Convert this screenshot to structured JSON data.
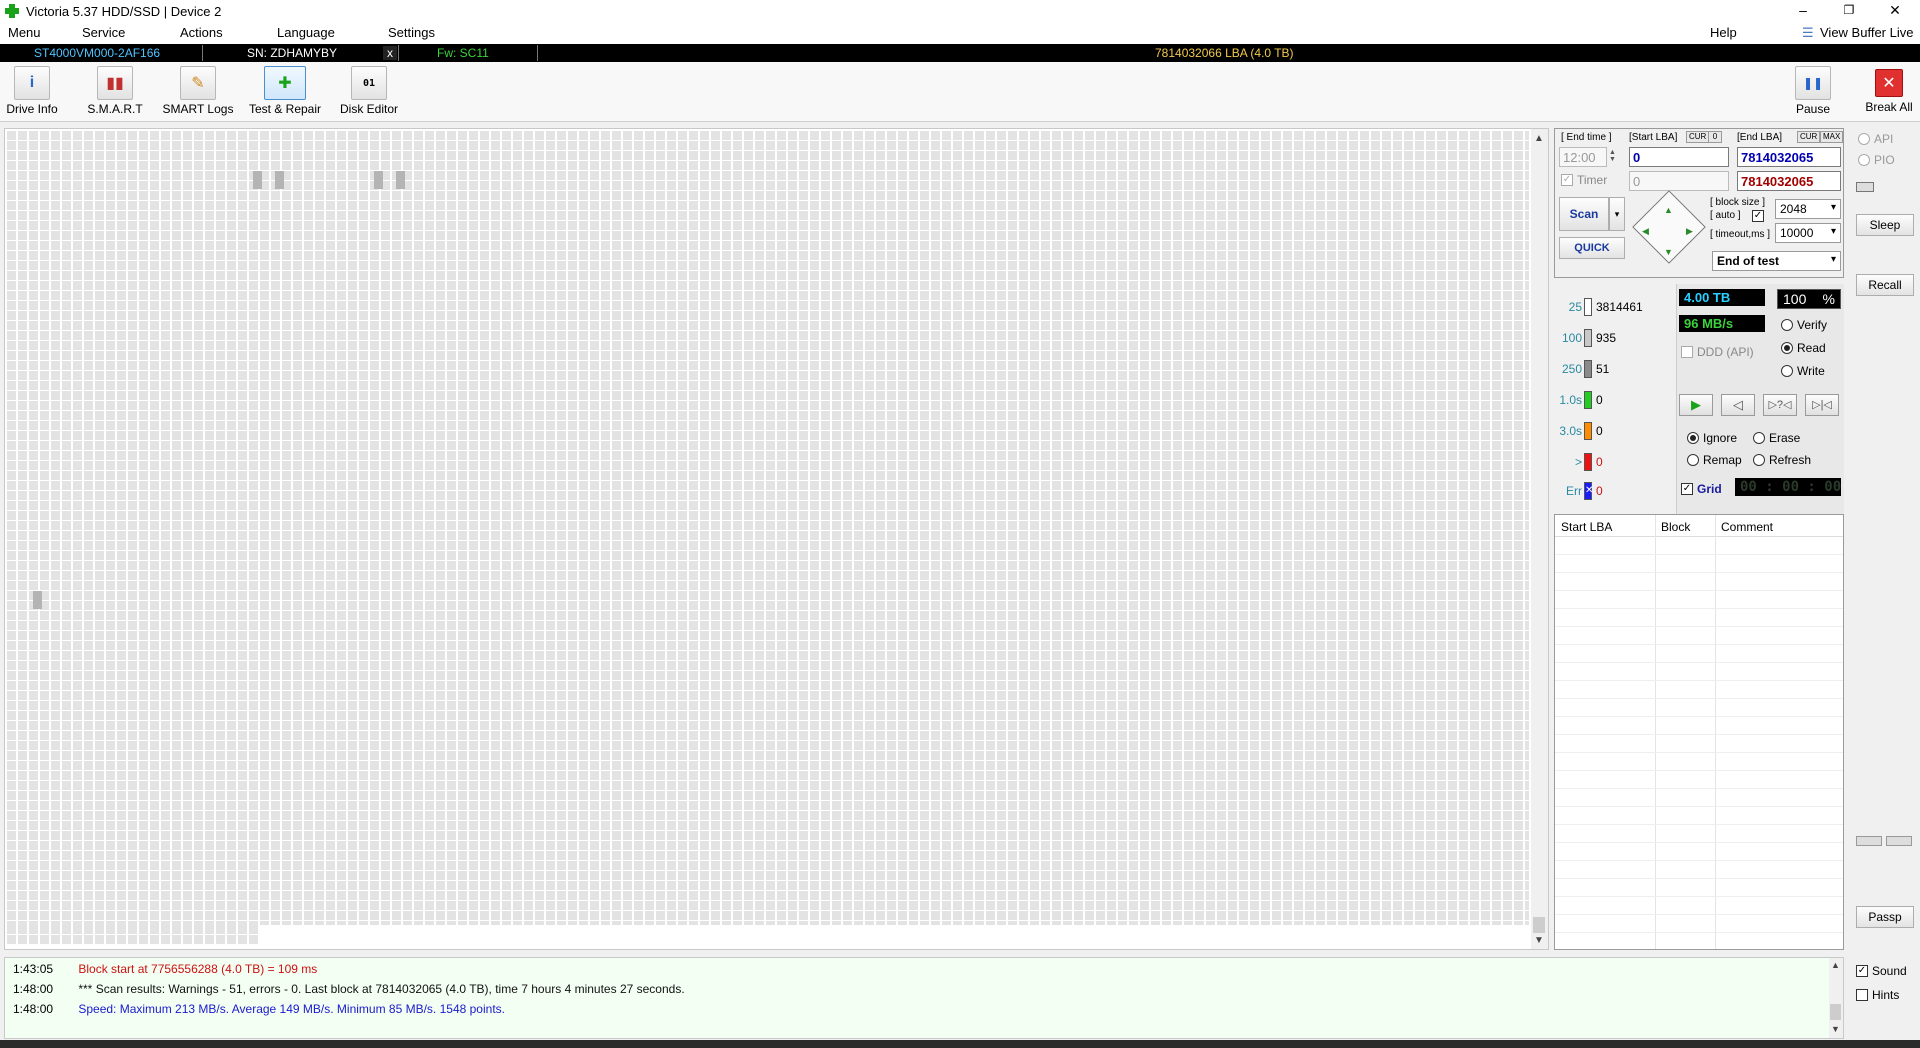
{
  "window": {
    "title": "Victoria 5.37 HDD/SSD | Device 2",
    "minimize": "–",
    "restore": "❐",
    "close": "✕"
  },
  "menu": {
    "items": [
      "Menu",
      "Service",
      "Actions",
      "Language",
      "Settings"
    ],
    "help": "Help",
    "view_buffer": "View Buffer Live"
  },
  "device": {
    "model": "ST4000VM000-2AF166",
    "serial": "SN: ZDHAMYBY",
    "eject": "x",
    "firmware": "Fw: SC11",
    "capacity": "7814032066 LBA (4.0 TB)",
    "colors": {
      "model": "#4fc3ff",
      "serial": "#ffffff",
      "firmware": "#3cd23c",
      "capacity": "#f2c94c"
    }
  },
  "toolbar": {
    "items": [
      {
        "label": "Drive Info",
        "icon": "info-icon",
        "glyph": "i"
      },
      {
        "label": "S.M.A.R.T",
        "icon": "smart-icon",
        "glyph": "▮▮"
      },
      {
        "label": "SMART Logs",
        "icon": "folder-icon",
        "glyph": "✎"
      },
      {
        "label": "Test & Repair",
        "icon": "plus-icon",
        "glyph": "✚"
      },
      {
        "label": "Disk Editor",
        "icon": "binary-icon",
        "glyph": "01"
      }
    ],
    "pause": {
      "label": "Pause",
      "glyph": "❚❚"
    },
    "break_all": {
      "label": "Break All",
      "glyph": "✕"
    }
  },
  "test": {
    "end_time_label": "[ End time ]",
    "end_time": "12:00",
    "timer_label": "Timer",
    "timer_value": "0",
    "start_lba_label": "[Start LBA]",
    "cur_chip": "CUR",
    "zero_chip": "0",
    "start_lba": "0",
    "end_lba_label": "[End LBA]",
    "max_chip": "MAX",
    "end_lba": "7814032065",
    "end_lba_current": "7814032065",
    "scan_label": "Scan",
    "quick_label": "QUICK",
    "block_size_label": "[ block size ]",
    "auto_label": "[ auto ]",
    "block_size": "2048",
    "timeout_label": "[ timeout,ms ]",
    "timeout": "10000",
    "end_action": "End of test"
  },
  "counters": [
    {
      "label": "25",
      "value": "3814461",
      "color": "#ffffff"
    },
    {
      "label": "100",
      "value": "935",
      "color": "#c8c8c8"
    },
    {
      "label": "250",
      "value": "51",
      "color": "#8a8a8a"
    },
    {
      "label": "1.0s",
      "value": "0",
      "color": "#22cc22"
    },
    {
      "label": "3.0s",
      "value": "0",
      "color": "#ff8c00"
    },
    {
      "label": ">",
      "value": "0",
      "color": "#ee1111"
    },
    {
      "label": "Err",
      "value": "0",
      "color": "#1a1aff"
    }
  ],
  "status": {
    "size": "4.00 TB",
    "speed": "96 MB/s",
    "percent": "100",
    "percent_sign": "%",
    "ddd": "DDD (API)",
    "modes": [
      "Verify",
      "Read",
      "Write"
    ],
    "selected_mode": "Read",
    "actions": [
      "Ignore",
      "Erase",
      "Remap",
      "Refresh"
    ],
    "selected_action": "Ignore",
    "grid_label": "Grid",
    "clock": "00 : 00 : 00"
  },
  "error_table": {
    "columns": [
      "Start LBA",
      "Block",
      "Comment"
    ]
  },
  "side": {
    "api": "API",
    "pio": "PIO",
    "sleep": "Sleep",
    "recall": "Recall",
    "passp": "Passp",
    "sound": "Sound",
    "hints": "Hints"
  },
  "log": [
    {
      "time": "1:43:05",
      "text": "Block start at 7756556288 (4.0 TB)  = 109 ms",
      "color": "#cc1111"
    },
    {
      "time": "1:48:00",
      "text": "*** Scan results: Warnings - 51, errors - 0. Last block at 7814032065 (4.0 TB), time 7 hours 4 minutes 27 seconds.",
      "color": "#111111"
    },
    {
      "time": "1:48:00",
      "text": "Speed: Maximum 213 MB/s. Average 149 MB/s. Minimum 85 MB/s. 1548 points.",
      "color": "#1a1acc"
    }
  ]
}
